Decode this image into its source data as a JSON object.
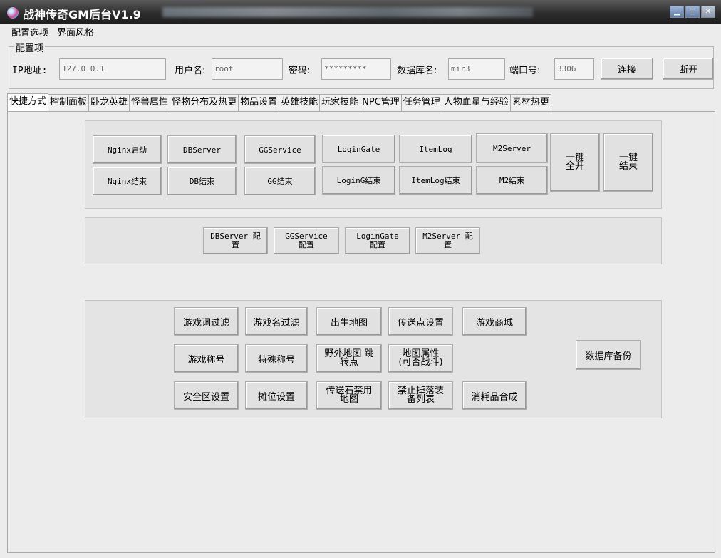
{
  "window": {
    "title": "战神传奇GM后台V1.9"
  },
  "menu": [
    "配置选项",
    "界面风格"
  ],
  "config": {
    "group_label": "配置项",
    "ip_label": "IP地址:",
    "ip_value": "127.0.0.1",
    "user_label": "用户名:",
    "user_value": "root",
    "password_label": "密码:",
    "password_value": "*********",
    "db_label": "数据库名:",
    "db_value": "mir3",
    "port_label": "端口号:",
    "port_value": "3306",
    "connect_label": "连接",
    "disconnect_label": "断开"
  },
  "tabs": [
    "快捷方式",
    "控制面板",
    "卧龙英雄",
    "怪兽属性",
    "怪物分布及热更",
    "物品设置",
    "英雄技能",
    "玩家技能",
    "NPC管理",
    "任务管理",
    "人物血量与经验",
    "素材热更"
  ],
  "server_buttons": {
    "nginx_start": "Nginx启动",
    "dbserver": "DBServer",
    "ggservice": "GGService",
    "logingate": "LoginGate",
    "itemlog": "ItemLog",
    "m2server": "M2Server",
    "nginx_stop": "Nginx结束",
    "db_stop": "DB结束",
    "gg_stop": "GG结束",
    "logingate_stop": "LoginG结束",
    "itemlog_stop": "ItemLog结束",
    "m2_stop": "M2结束",
    "start_all": "一键\n全开",
    "stop_all": "一键\n结束"
  },
  "config_buttons": {
    "dbserver_cfg": "DBServer 配\n置",
    "ggservice_cfg": "GGService\n配置",
    "logingate_cfg": "LoginGate\n配置",
    "m2server_cfg": "M2Server 配\n置"
  },
  "game_buttons": {
    "word_filter": "游戏词过滤",
    "name_filter": "游戏名过滤",
    "spawn_map": "出生地图",
    "teleport": "传送点设置",
    "shop": "游戏商城",
    "titles": "游戏称号",
    "special_titles": "特殊称号",
    "wild_map": "野外地图 跳\n转点",
    "map_attr": "地图属性\n(可否战斗)",
    "safe_zone": "安全区设置",
    "stall": "摊位设置",
    "teleport_stone": "传送石禁用\n地图",
    "no_drop": "禁止掉落装\n备列表",
    "consumable": "消耗品合成",
    "db_backup": "数据库备份"
  }
}
